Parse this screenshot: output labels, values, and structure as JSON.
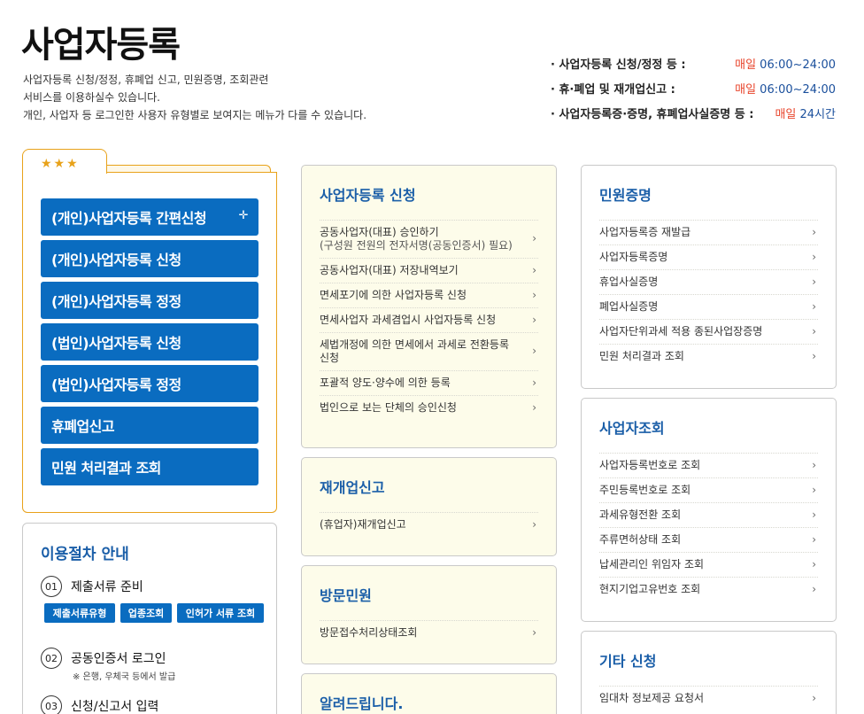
{
  "header": {
    "title": "사업자등록",
    "desc": [
      "사업자등록 신청/정정, 휴폐업 신고, 민원증명, 조회관련",
      "서비스를 이용하실수 있습니다.",
      "개인, 사업자 등 로그인한 사용자 유형별로 보여지는 메뉴가 다를 수 있습니다."
    ]
  },
  "hours": [
    {
      "label": "· 사업자등록 신청/정정 등 :",
      "day": "매일",
      "time": "06:00~24:00"
    },
    {
      "label": "· 휴·폐업 및 재개업신고 :",
      "day": "매일",
      "time": "06:00~24:00"
    },
    {
      "label": "· 사업자등록증·증명, 휴폐업사실증명 등 :",
      "day": "매일",
      "time": "24시간"
    }
  ],
  "quick": {
    "stars": "★★★",
    "buttons": [
      "(개인)사업자등록 간편신청",
      "(개인)사업자등록 신청",
      "(개인)사업자등록 정정",
      "(법인)사업자등록 신청",
      "(법인)사업자등록 정정",
      "휴폐업신고",
      "민원 처리결과 조회"
    ],
    "plus": "✛"
  },
  "procedure": {
    "title": "이용절차 안내",
    "steps": [
      {
        "num": "01",
        "label": "제출서류 준비"
      },
      {
        "num": "02",
        "label": "공동인증서 로그인",
        "sub": "※ 은행, 우체국 등에서 발급"
      },
      {
        "num": "03",
        "label": "신청/신고서 입력"
      }
    ],
    "chips": [
      "제출서류유형",
      "업종조회",
      "인허가 서류 조회"
    ]
  },
  "chevron": "›",
  "cards": {
    "registration": {
      "title": "사업자등록 신청",
      "items": [
        {
          "label": "공동사업자(대표) 승인하기",
          "sub": "(구성원 전원의 전자서명(공동인증서) 필요)"
        },
        {
          "label": "공동사업자(대표) 저장내역보기"
        },
        {
          "label": "면세포기에 의한 사업자등록 신청"
        },
        {
          "label": "면세사업자 과세겸업시 사업자등록 신청"
        },
        {
          "label": "세법개정에 의한 면세에서 과세로 전환등록 신청"
        },
        {
          "label": "포괄적 양도·양수에 의한 등록"
        },
        {
          "label": "법인으로 보는 단체의 승인신청"
        }
      ]
    },
    "reopen": {
      "title": "재개업신고",
      "items": [
        {
          "label": "(휴업자)재개업신고"
        }
      ]
    },
    "visit": {
      "title": "방문민원",
      "items": [
        {
          "label": "방문접수처리상태조회"
        }
      ]
    },
    "notice": {
      "title": "알려드립니다."
    },
    "certificate": {
      "title": "민원증명",
      "items": [
        {
          "label": "사업자등록증 재발급"
        },
        {
          "label": "사업자등록증명"
        },
        {
          "label": "휴업사실증명"
        },
        {
          "label": "폐업사실증명"
        },
        {
          "label": "사업자단위과세 적용 종된사업장증명"
        },
        {
          "label": "민원 처리결과 조회"
        }
      ]
    },
    "lookup": {
      "title": "사업자조회",
      "items": [
        {
          "label": "사업자등록번호로 조회"
        },
        {
          "label": "주민등록번호로 조회"
        },
        {
          "label": "과세유형전환 조회"
        },
        {
          "label": "주류면허상태 조회"
        },
        {
          "label": "납세관리인 위임자 조회"
        },
        {
          "label": "현지기업고유번호 조회"
        }
      ]
    },
    "etc": {
      "title": "기타 신청",
      "items": [
        {
          "label": "임대차 정보제공 요청서"
        }
      ]
    }
  }
}
